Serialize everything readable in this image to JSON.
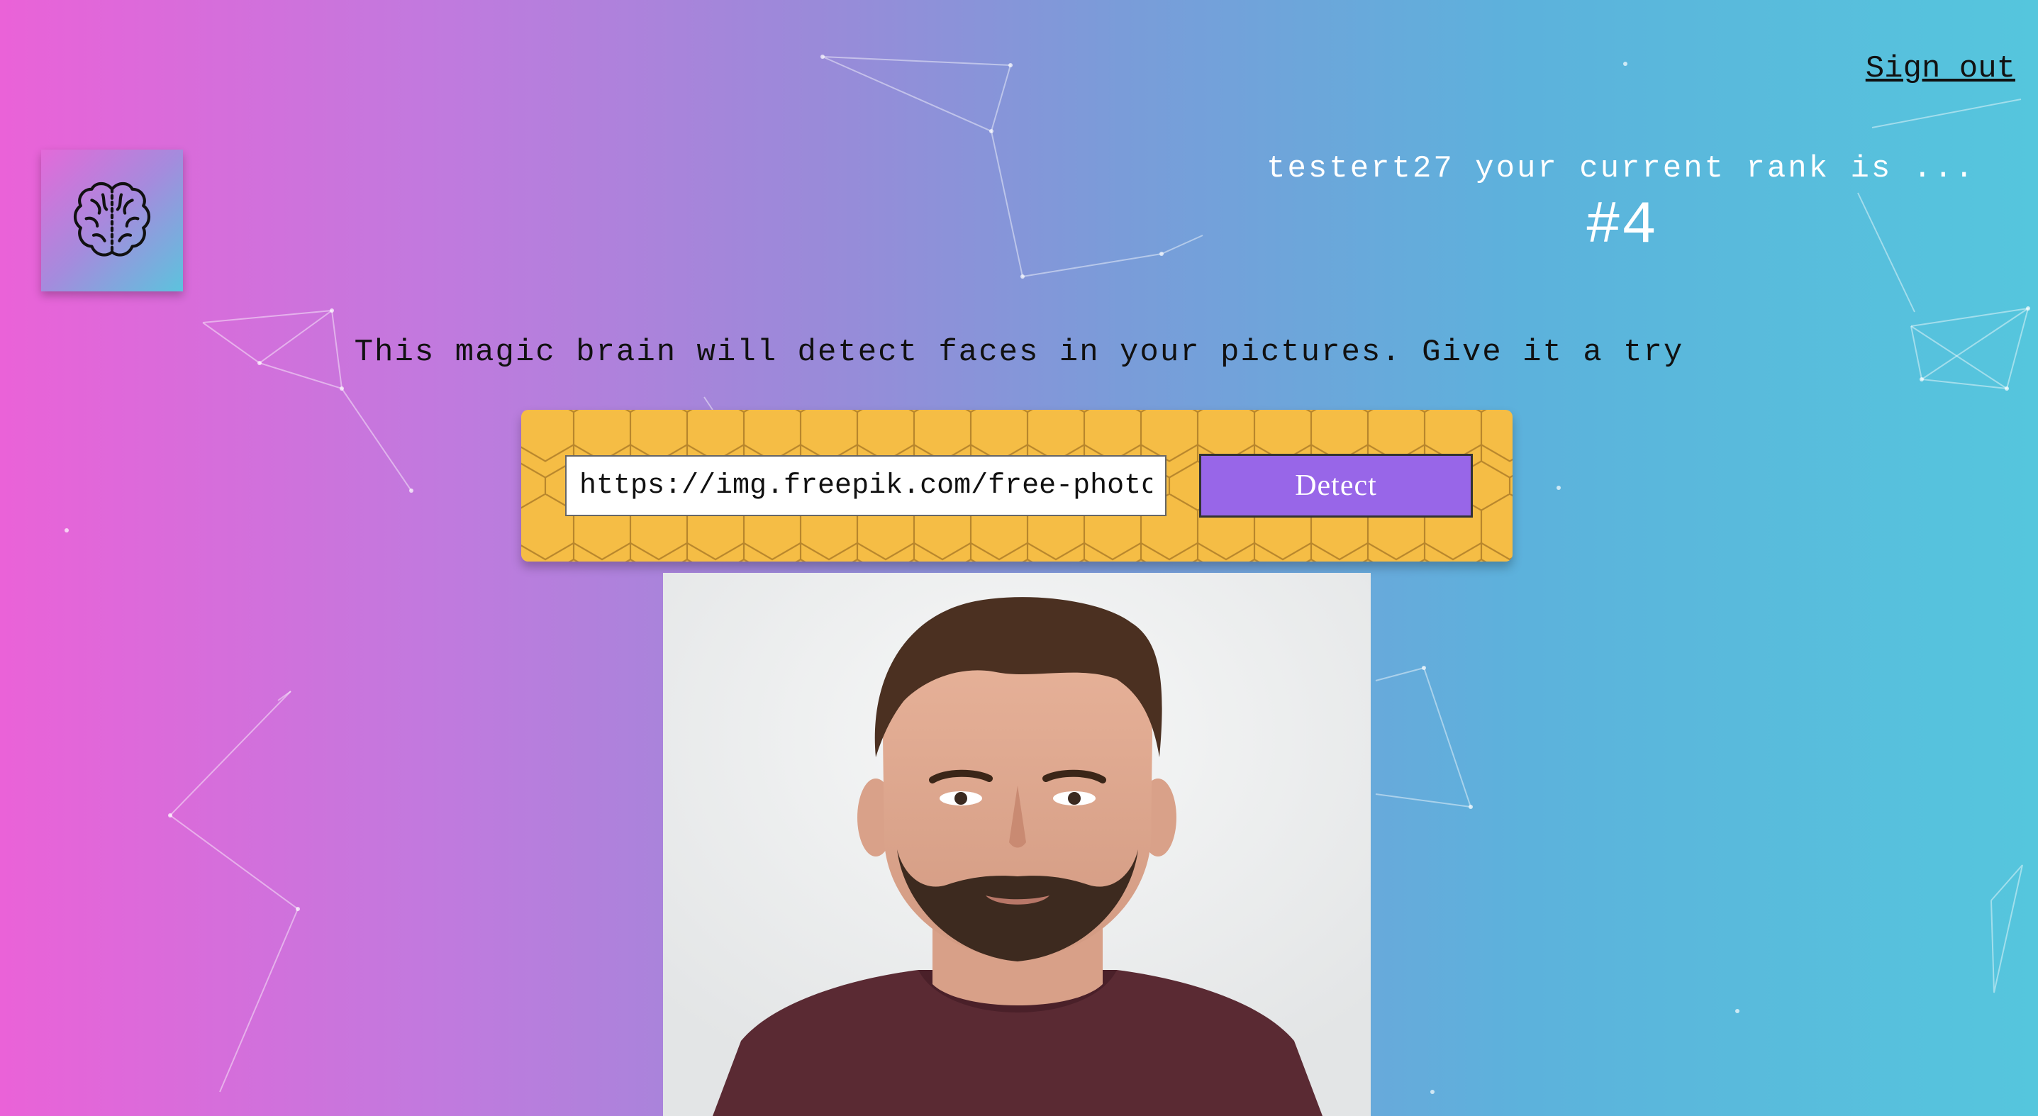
{
  "header": {
    "signout_label": "Sign out",
    "logo_icon": "brain-icon"
  },
  "rank": {
    "text": "testert27 your current rank is ...",
    "value": "#4"
  },
  "tagline": "This magic brain will detect faces in your pictures. Give it a try",
  "form": {
    "url_value": "https://img.freepik.com/free-photo/p",
    "detect_label": "Detect"
  },
  "colors": {
    "gradient_start": "#ea62d8",
    "gradient_end": "#55c6dd",
    "panel": "#f5bd45",
    "detect_button": "#9866e8"
  }
}
